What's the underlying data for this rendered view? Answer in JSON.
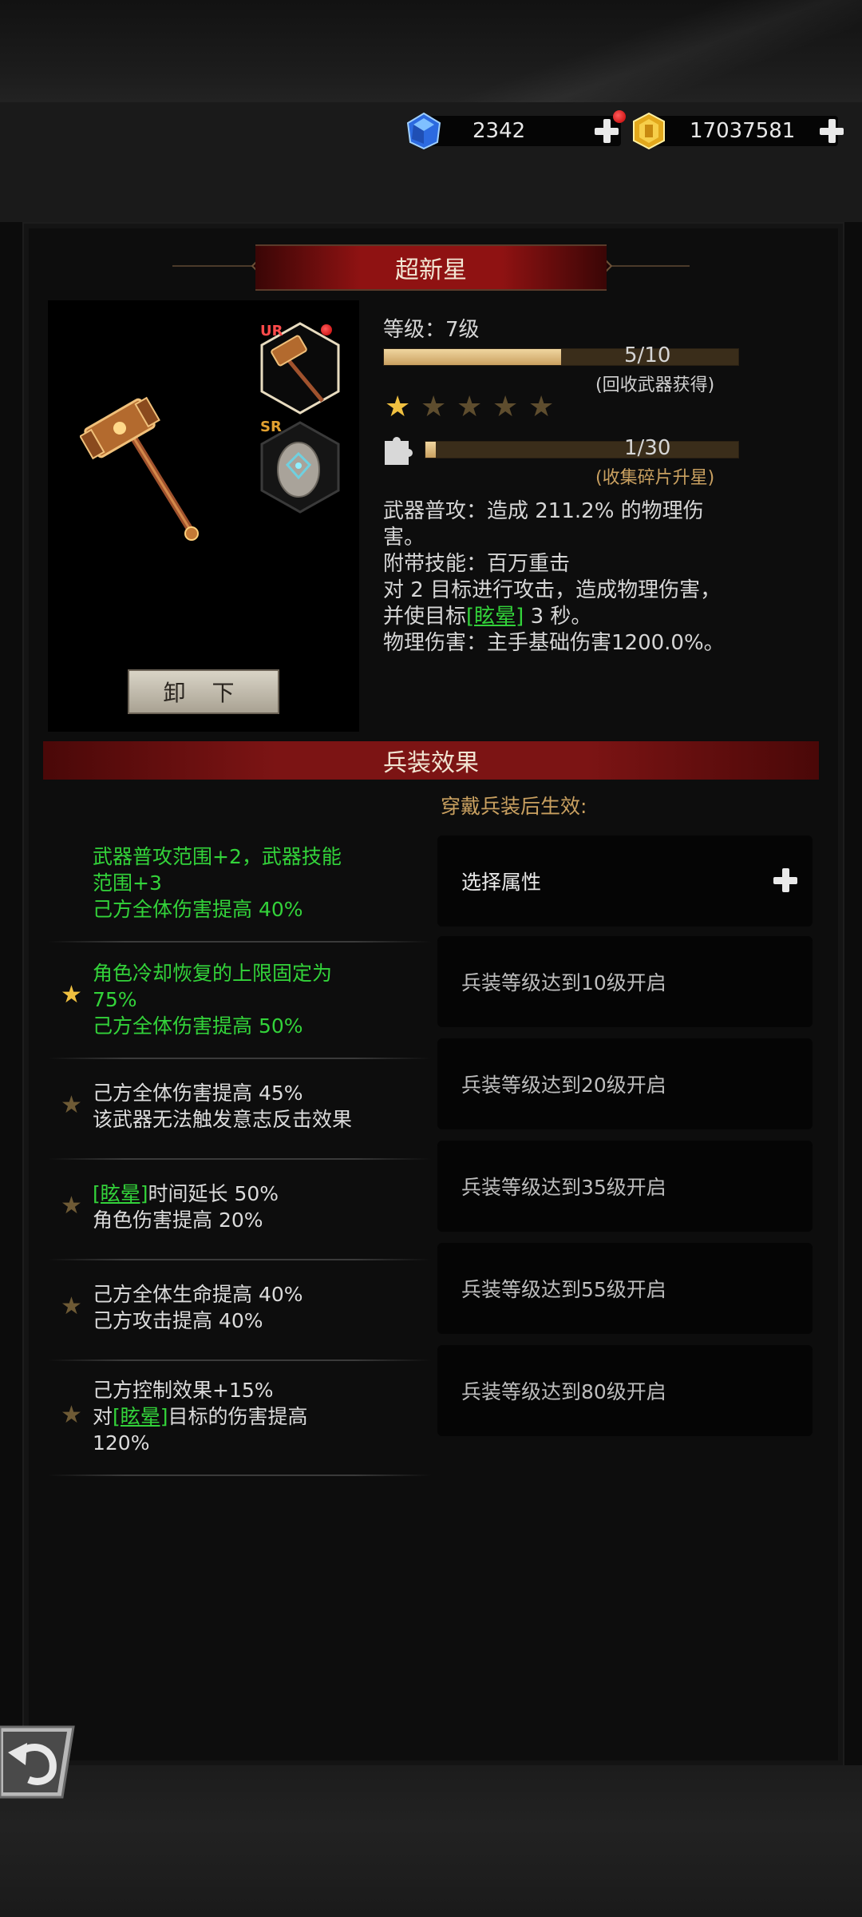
{
  "currency": {
    "gems": "2342",
    "gold": "17037581"
  },
  "weapon": {
    "name": "超新星",
    "unequip_label": "卸 下",
    "ur_badge": "UR",
    "sr_badge": "SR",
    "level_text": "等级：7级",
    "exp_progress": "5/10",
    "exp_fraction": 0.5,
    "exp_hint": "(回收武器获得)",
    "stars_filled": 1,
    "stars_total": 5,
    "fragment_progress": "1/30",
    "fragment_fraction": 0.033,
    "fragment_hint": "(收集碎片升星)",
    "desc": {
      "attack_prefix": "武器普攻：造成 211.2% 的物理伤",
      "attack_suffix": "害。",
      "skill_line": "附带技能：百万重击",
      "skill_detail": "对 2 目标进行攻击，造成物理伤害，",
      "stun_prefix": "并使目标",
      "stun_link": "[眩晕]",
      "stun_suffix": " 3 秒。",
      "physical_damage": "物理伤害：主手基础伤害1200.0%。"
    }
  },
  "effects": {
    "banner": "兵装效果",
    "wear_hint": "穿戴兵装后生效:",
    "select_attr": "选择属性",
    "rows": [
      {
        "line1": "武器普攻范围+2，武器技能",
        "line2": "范围+3",
        "line3": "己方全体伤害提高 40%"
      },
      {
        "line1": "角色冷却恢复的上限固定为",
        "line2": "75%",
        "line3": "己方全体伤害提高 50%"
      },
      {
        "line1": "己方全体伤害提高 45%",
        "line2": "该武器无法触发意志反击效果"
      },
      {
        "link": "[眩晕]",
        "line1_suffix": "时间延长 50%",
        "line2": "角色伤害提高 20%"
      },
      {
        "line1": "己方全体生命提高 40%",
        "line2": "己方攻击提高 40%"
      },
      {
        "line1": "己方控制效果+15%",
        "line2_prefix": "对",
        "link": "[眩晕]",
        "line2_suffix": "目标的伤害提高",
        "line3": "120%"
      }
    ],
    "slots": [
      "兵装等级达到10级开启",
      "兵装等级达到20级开启",
      "兵装等级达到35级开启",
      "兵装等级达到55级开启",
      "兵装等级达到80级开启"
    ]
  },
  "colors": {
    "accent_red": "#8f1212",
    "gold": "#c9a060",
    "active_green": "#33d33a"
  },
  "icons": [
    "blue-gem-icon",
    "gold-coin-icon",
    "plus-icon",
    "hammer-icon",
    "shield-stone-icon",
    "star-icon",
    "puzzle-icon",
    "back-arrow-icon"
  ]
}
